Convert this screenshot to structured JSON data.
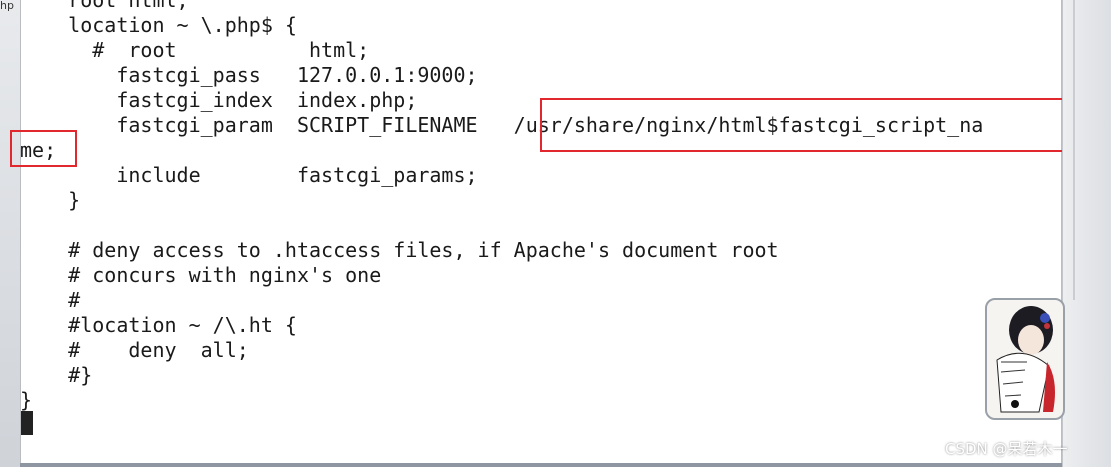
{
  "left_strip": {
    "label": "hp"
  },
  "code_lines": [
    "    root html;",
    "    location ~ \\.php$ {",
    "      #  root           html;",
    "        fastcgi_pass   127.0.0.1:9000;",
    "        fastcgi_index  index.php;",
    "        fastcgi_param  SCRIPT_FILENAME   /usr/share/nginx/html$fastcgi_script_na",
    "me;",
    "        include        fastcgi_params;",
    "    }",
    "",
    "    # deny access to .htaccess files, if Apache's document root",
    "    # concurs with nginx's one",
    "    #",
    "    #location ~ /\\.ht {",
    "    #    deny  all;",
    "    #}",
    "}"
  ],
  "watermark": "CSDN @呆若木一",
  "colors": {
    "highlight": "#e0282e",
    "text": "#1a1a1a",
    "terminal_bg": "#ffffff"
  }
}
